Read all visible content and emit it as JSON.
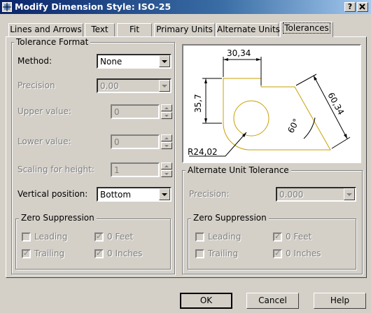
{
  "window": {
    "title": "Modify Dimension Style: ISO-25",
    "help_btn": "?",
    "close_btn": "X"
  },
  "tabs": [
    {
      "label": "Lines and Arrows"
    },
    {
      "label": "Text"
    },
    {
      "label": "Fit"
    },
    {
      "label": "Primary Units"
    },
    {
      "label": "Alternate Units"
    },
    {
      "label": "Tolerances"
    }
  ],
  "tolerance_format": {
    "title": "Tolerance Format",
    "method_label": "Method:",
    "method_value": "None",
    "precision_label": "Precision",
    "precision_value": "0.00",
    "upper_label": "Upper value:",
    "upper_value": "0",
    "lower_label": "Lower value:",
    "lower_value": "0",
    "scaling_label": "Scaling for height:",
    "scaling_value": "1",
    "vertical_label": "Vertical position:",
    "vertical_value": "Bottom"
  },
  "zero_suppression_left": {
    "title": "Zero Suppression",
    "leading": "Leading",
    "trailing": "Trailing",
    "feet": "0 Feet",
    "inches": "0 Inches"
  },
  "preview": {
    "dim_top": "30,34",
    "dim_left": "35,7",
    "dim_right": "60,34",
    "dim_angle": "60°",
    "dim_radius": "R24,02",
    "line_color": "#c8a000"
  },
  "alternate_tolerance": {
    "title": "Alternate Unit Tolerance",
    "precision_label": "Precision:",
    "precision_value": "0.000"
  },
  "zero_suppression_right": {
    "title": "Zero Suppression",
    "leading": "Leading",
    "trailing": "Trailing",
    "feet": "0 Feet",
    "inches": "0 Inches"
  },
  "buttons": {
    "ok": "OK",
    "cancel": "Cancel",
    "help": "Help"
  }
}
